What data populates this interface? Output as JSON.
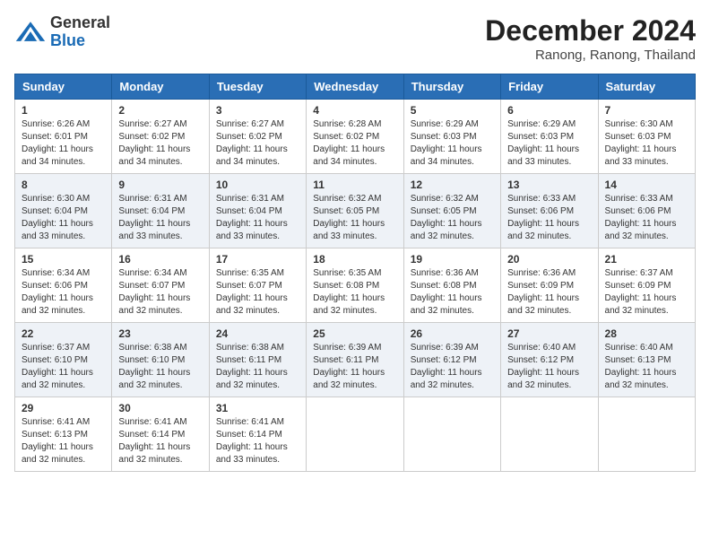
{
  "logo": {
    "general": "General",
    "blue": "Blue"
  },
  "title": {
    "month_year": "December 2024",
    "location": "Ranong, Ranong, Thailand"
  },
  "days_of_week": [
    "Sunday",
    "Monday",
    "Tuesday",
    "Wednesday",
    "Thursday",
    "Friday",
    "Saturday"
  ],
  "weeks": [
    [
      {
        "day": "1",
        "sunrise": "6:26 AM",
        "sunset": "6:01 PM",
        "daylight": "11 hours and 34 minutes."
      },
      {
        "day": "2",
        "sunrise": "6:27 AM",
        "sunset": "6:02 PM",
        "daylight": "11 hours and 34 minutes."
      },
      {
        "day": "3",
        "sunrise": "6:27 AM",
        "sunset": "6:02 PM",
        "daylight": "11 hours and 34 minutes."
      },
      {
        "day": "4",
        "sunrise": "6:28 AM",
        "sunset": "6:02 PM",
        "daylight": "11 hours and 34 minutes."
      },
      {
        "day": "5",
        "sunrise": "6:29 AM",
        "sunset": "6:03 PM",
        "daylight": "11 hours and 34 minutes."
      },
      {
        "day": "6",
        "sunrise": "6:29 AM",
        "sunset": "6:03 PM",
        "daylight": "11 hours and 33 minutes."
      },
      {
        "day": "7",
        "sunrise": "6:30 AM",
        "sunset": "6:03 PM",
        "daylight": "11 hours and 33 minutes."
      }
    ],
    [
      {
        "day": "8",
        "sunrise": "6:30 AM",
        "sunset": "6:04 PM",
        "daylight": "11 hours and 33 minutes."
      },
      {
        "day": "9",
        "sunrise": "6:31 AM",
        "sunset": "6:04 PM",
        "daylight": "11 hours and 33 minutes."
      },
      {
        "day": "10",
        "sunrise": "6:31 AM",
        "sunset": "6:04 PM",
        "daylight": "11 hours and 33 minutes."
      },
      {
        "day": "11",
        "sunrise": "6:32 AM",
        "sunset": "6:05 PM",
        "daylight": "11 hours and 33 minutes."
      },
      {
        "day": "12",
        "sunrise": "6:32 AM",
        "sunset": "6:05 PM",
        "daylight": "11 hours and 32 minutes."
      },
      {
        "day": "13",
        "sunrise": "6:33 AM",
        "sunset": "6:06 PM",
        "daylight": "11 hours and 32 minutes."
      },
      {
        "day": "14",
        "sunrise": "6:33 AM",
        "sunset": "6:06 PM",
        "daylight": "11 hours and 32 minutes."
      }
    ],
    [
      {
        "day": "15",
        "sunrise": "6:34 AM",
        "sunset": "6:06 PM",
        "daylight": "11 hours and 32 minutes."
      },
      {
        "day": "16",
        "sunrise": "6:34 AM",
        "sunset": "6:07 PM",
        "daylight": "11 hours and 32 minutes."
      },
      {
        "day": "17",
        "sunrise": "6:35 AM",
        "sunset": "6:07 PM",
        "daylight": "11 hours and 32 minutes."
      },
      {
        "day": "18",
        "sunrise": "6:35 AM",
        "sunset": "6:08 PM",
        "daylight": "11 hours and 32 minutes."
      },
      {
        "day": "19",
        "sunrise": "6:36 AM",
        "sunset": "6:08 PM",
        "daylight": "11 hours and 32 minutes."
      },
      {
        "day": "20",
        "sunrise": "6:36 AM",
        "sunset": "6:09 PM",
        "daylight": "11 hours and 32 minutes."
      },
      {
        "day": "21",
        "sunrise": "6:37 AM",
        "sunset": "6:09 PM",
        "daylight": "11 hours and 32 minutes."
      }
    ],
    [
      {
        "day": "22",
        "sunrise": "6:37 AM",
        "sunset": "6:10 PM",
        "daylight": "11 hours and 32 minutes."
      },
      {
        "day": "23",
        "sunrise": "6:38 AM",
        "sunset": "6:10 PM",
        "daylight": "11 hours and 32 minutes."
      },
      {
        "day": "24",
        "sunrise": "6:38 AM",
        "sunset": "6:11 PM",
        "daylight": "11 hours and 32 minutes."
      },
      {
        "day": "25",
        "sunrise": "6:39 AM",
        "sunset": "6:11 PM",
        "daylight": "11 hours and 32 minutes."
      },
      {
        "day": "26",
        "sunrise": "6:39 AM",
        "sunset": "6:12 PM",
        "daylight": "11 hours and 32 minutes."
      },
      {
        "day": "27",
        "sunrise": "6:40 AM",
        "sunset": "6:12 PM",
        "daylight": "11 hours and 32 minutes."
      },
      {
        "day": "28",
        "sunrise": "6:40 AM",
        "sunset": "6:13 PM",
        "daylight": "11 hours and 32 minutes."
      }
    ],
    [
      {
        "day": "29",
        "sunrise": "6:41 AM",
        "sunset": "6:13 PM",
        "daylight": "11 hours and 32 minutes."
      },
      {
        "day": "30",
        "sunrise": "6:41 AM",
        "sunset": "6:14 PM",
        "daylight": "11 hours and 32 minutes."
      },
      {
        "day": "31",
        "sunrise": "6:41 AM",
        "sunset": "6:14 PM",
        "daylight": "11 hours and 33 minutes."
      },
      null,
      null,
      null,
      null
    ]
  ]
}
